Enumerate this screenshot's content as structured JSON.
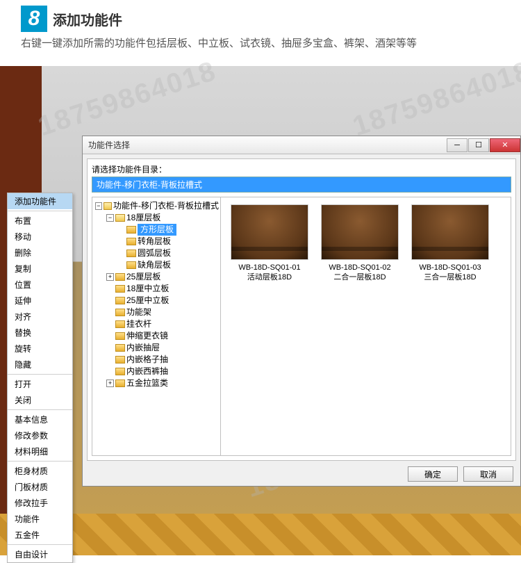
{
  "watermark": "18759864018",
  "header": {
    "step_number": "8",
    "title": "添加功能件",
    "description": "右键一键添加所需的功能件包括层板、中立板、试衣镜、抽屉多宝盒、裤架、酒架等等"
  },
  "context_menu": {
    "groups": [
      [
        "添加功能件"
      ],
      [
        "布置",
        "移动",
        "删除",
        "复制",
        "位置",
        "延伸",
        "对齐",
        "替换",
        "旋转",
        "隐藏"
      ],
      [
        "打开",
        "关闭"
      ],
      [
        "基本信息",
        "修改参数",
        "材料明细"
      ],
      [
        "柜身材质",
        "门板材质",
        "修改拉手",
        "功能件",
        "五金件"
      ],
      [
        "自由设计"
      ]
    ],
    "selected": "添加功能件"
  },
  "dialog": {
    "title": "功能件选择",
    "prompt": "请选择功能件目录：",
    "path_bar": "功能件-移门衣柜-背板拉槽式",
    "buttons": {
      "ok": "确定",
      "cancel": "取消"
    },
    "win_buttons": {
      "min": "─",
      "max": "☐",
      "close": "✕"
    }
  },
  "tree": {
    "root": {
      "label": "功能件-移门衣柜-背板拉槽式",
      "expanded": true,
      "children": [
        {
          "label": "18厘层板",
          "expanded": true,
          "children": [
            {
              "label": "方形层板",
              "selected": true
            },
            {
              "label": "转角层板"
            },
            {
              "label": "圆弧层板"
            },
            {
              "label": "缺角层板"
            }
          ]
        },
        {
          "label": "25厘层板",
          "expanded": false,
          "children": []
        },
        {
          "label": "18厘中立板"
        },
        {
          "label": "25厘中立板"
        },
        {
          "label": "功能架"
        },
        {
          "label": "挂衣杆"
        },
        {
          "label": "伸缩更衣镜"
        },
        {
          "label": "内嵌抽屉"
        },
        {
          "label": "内嵌格子抽"
        },
        {
          "label": "内嵌西裤抽"
        },
        {
          "label": "五金拉篮类",
          "expanded": false,
          "children": []
        }
      ]
    }
  },
  "thumbnails": [
    {
      "code": "WB-18D-SQ01-01",
      "name": "活动层板18D"
    },
    {
      "code": "WB-18D-SQ01-02",
      "name": "二合一层板18D"
    },
    {
      "code": "WB-18D-SQ01-03",
      "name": "三合一层板18D"
    }
  ]
}
